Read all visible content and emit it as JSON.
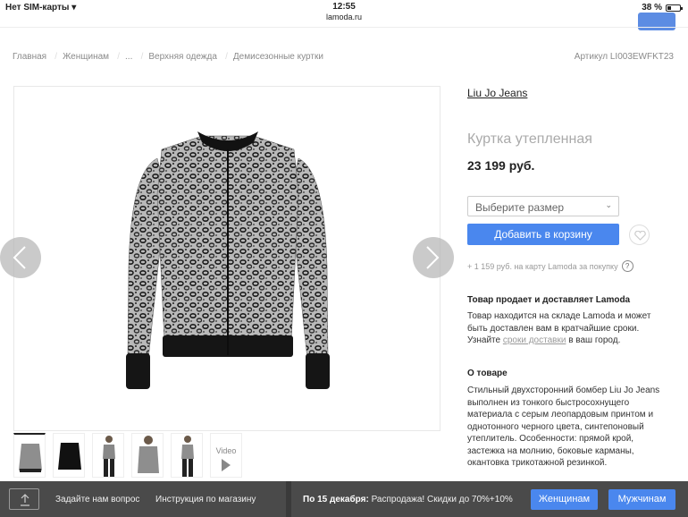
{
  "status_bar": {
    "carrier": "Нет SIM-карты",
    "time": "12:55",
    "url": "lamoda.ru",
    "battery": "38 %"
  },
  "breadcrumbs": [
    "Главная",
    "Женщинам",
    "...",
    "Верхняя одежда",
    "Демисезонные куртки"
  ],
  "article": "Артикул LI003EWFKT23",
  "product": {
    "brand": "Liu Jo Jeans",
    "title": "Куртка утепленная",
    "price": "23 199 руб.",
    "size_placeholder": "Выберите размер",
    "add_to_cart": "Добавить в корзину",
    "bonus": "+ 1 159 руб. на карту Lamoda за покупку"
  },
  "delivery": {
    "title": "Товар продает и доставляет Lamoda",
    "text_before": "Товар находится на складе Lamoda и может быть доставлен вам в кратчайшие сроки. Узнайте ",
    "link": "сроки доставки",
    "text_after": " в ваш город."
  },
  "about": {
    "title": "О товаре",
    "text": "Стильный двухсторонний бомбер Liu Jo Jeans выполнен из тонкого быстросохнущего материала с серым леопардовым принтом и однотонного черного цвета, синтепоновый утеплитель. Особенности: прямой крой, застежка на молнию, боковые карманы, окантовка трикотажной резинкой."
  },
  "thumbnails": {
    "video_label": "Video"
  },
  "bottom_bar": {
    "ask": "Задайте нам вопрос",
    "instructions": "Инструкция по магазину",
    "promo_date": "По 15 декабря:",
    "promo_text": "Распродажа! Скидки до 70%+10%",
    "women": "Женщинам",
    "men": "Мужчинам"
  },
  "colors": {
    "accent": "#4a87ee",
    "bottom_bar": "#4a4a4a"
  }
}
